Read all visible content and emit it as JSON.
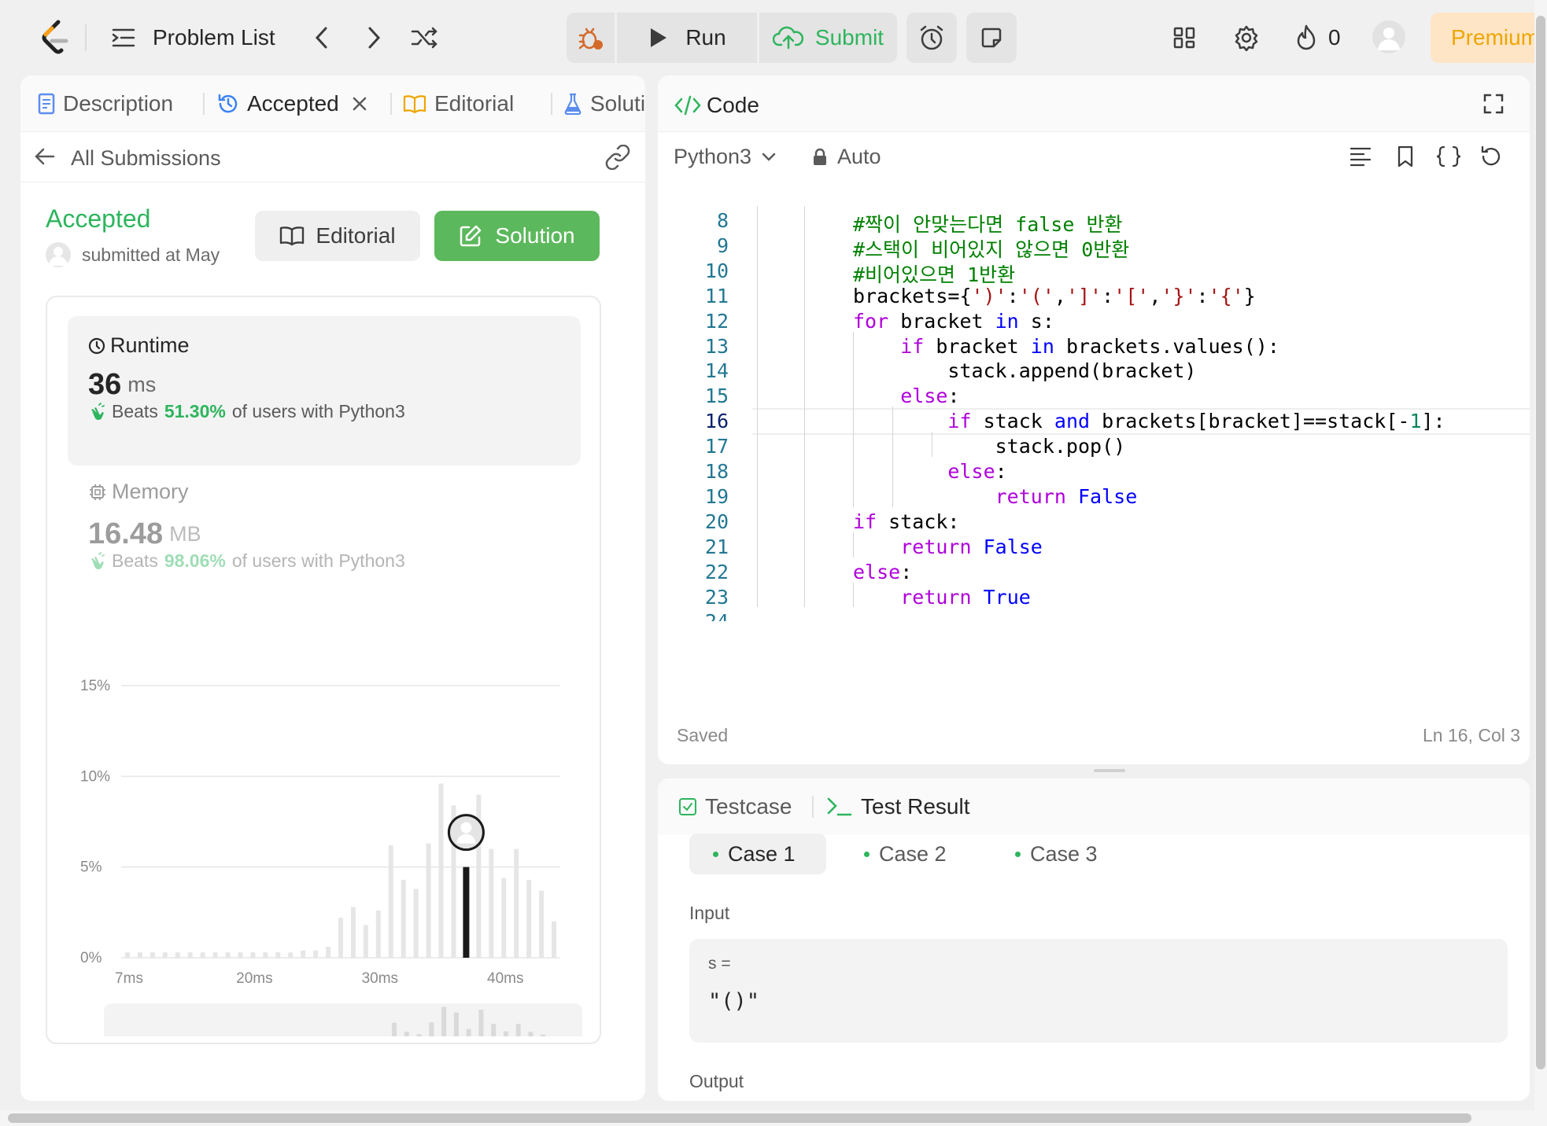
{
  "topbar": {
    "problem_list": "Problem List",
    "run": "Run",
    "submit": "Submit",
    "streak": "0",
    "premium": "Premium"
  },
  "left_tabs": [
    {
      "label": "Description"
    },
    {
      "label": "Accepted"
    },
    {
      "label": "Editorial"
    },
    {
      "label": "Solutions"
    }
  ],
  "submission": {
    "back_label": "All Submissions",
    "status": "Accepted",
    "submitted_text": "submitted at May",
    "editorial_button": "Editorial",
    "solution_button": "Solution",
    "runtime": {
      "title": "Runtime",
      "value": "36",
      "unit": "ms",
      "beats_prefix": "Beats",
      "beats_pct": "51.30%",
      "beats_suffix": "of users with Python3"
    },
    "memory": {
      "title": "Memory",
      "value": "16.48",
      "unit": "MB",
      "beats_prefix": "Beats",
      "beats_pct": "98.06%",
      "beats_suffix": "of users with Python3"
    }
  },
  "chart_data": {
    "type": "bar",
    "y_ticks": [
      "15%",
      "10%",
      "5%",
      "0%"
    ],
    "x_ticks": [
      "7ms",
      "20ms",
      "30ms",
      "40ms"
    ],
    "ylim": [
      0,
      15
    ],
    "values": [
      0.3,
      0.3,
      0.3,
      0.3,
      0.3,
      0.3,
      0.3,
      0.3,
      0.3,
      0.3,
      0.3,
      0.3,
      0.3,
      0.3,
      0.4,
      0.4,
      0.6,
      2.2,
      2.8,
      1.8,
      2.6,
      6.2,
      4.3,
      3.8,
      6.3,
      9.6,
      8.4,
      4.9,
      9.0,
      6.0,
      4.4,
      6.0,
      4.3,
      3.7,
      2.0
    ],
    "highlight_index": 27,
    "highlight_value": 5.0,
    "grid": true
  },
  "code": {
    "title": "Code",
    "language": "Python3",
    "mode": "Auto",
    "status": "Saved",
    "cursor": "Ln 16, Col 3",
    "start_line": 8,
    "current_line": 16
  },
  "results": {
    "testcase_tab": "Testcase",
    "result_tab": "Test Result",
    "cases": [
      "Case 1",
      "Case 2",
      "Case 3"
    ],
    "input_label": "Input",
    "input_var": "s =",
    "input_value": "\"()\"",
    "output_label": "Output"
  }
}
